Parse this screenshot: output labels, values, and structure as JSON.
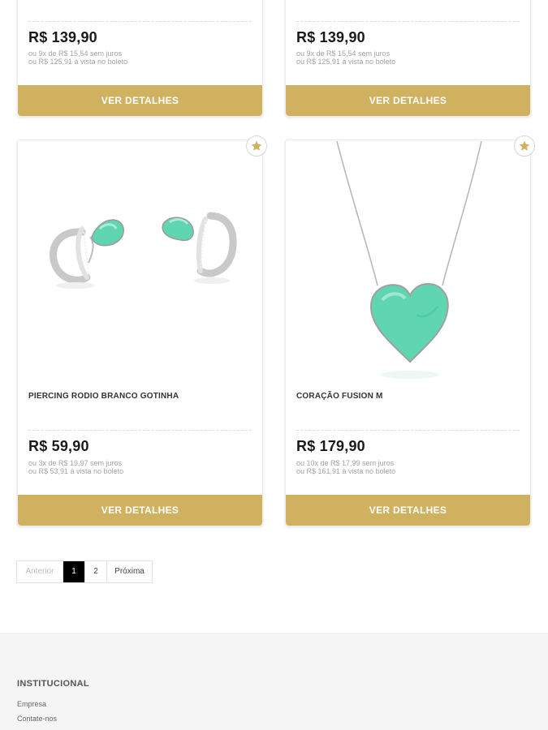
{
  "products": [
    {
      "name": "",
      "price": "R$ 139,90",
      "installments": "ou 9x de R$ 15,54 sem juros",
      "boleto": "ou R$ 125,91 à vista no boleto",
      "button": "VER DETALHES"
    },
    {
      "name": "",
      "price": "R$ 139,90",
      "installments": "ou 9x de R$ 15,54 sem juros",
      "boleto": "ou R$ 125,91 à vista no boleto",
      "button": "VER DETALHES"
    },
    {
      "name": "PIERCING RODIO BRANCO GOTINHA",
      "price": "R$ 59,90",
      "installments": "ou 3x de R$ 19,97 sem juros",
      "boleto": "ou R$ 53,91 à vista no boleto",
      "button": "VER DETALHES"
    },
    {
      "name": "CORAÇÃO FUSION M",
      "price": "R$ 179,90",
      "installments": "ou 10x de R$ 17,99 sem juros",
      "boleto": "ou R$ 161,91 à vista no boleto",
      "button": "VER DETALHES"
    }
  ],
  "pagination": {
    "prev": "Anterior",
    "pages": [
      "1",
      "2"
    ],
    "active": "1",
    "next": "Próxima"
  },
  "footer": {
    "title": "INSTITUCIONAL",
    "links": [
      "Empresa",
      "Contate-nos"
    ]
  },
  "colors": {
    "accent": "#cfb160",
    "gem": "#5fd6b0"
  },
  "icons": {
    "favorite": "star-icon"
  }
}
